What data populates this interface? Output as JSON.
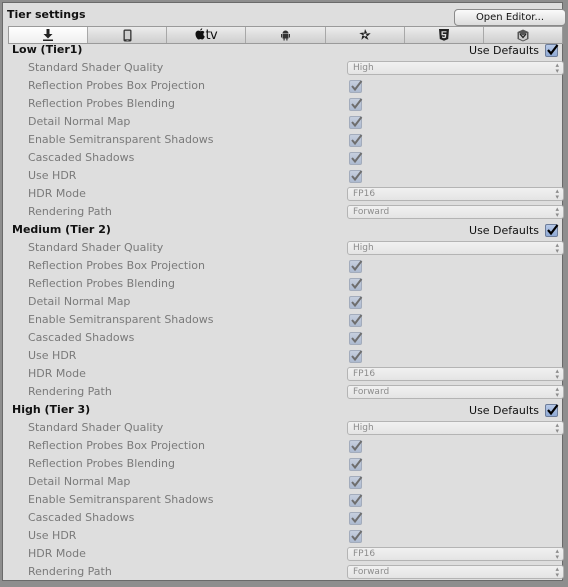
{
  "header": {
    "title": "Tier settings",
    "open_editor_label": "Open Editor..."
  },
  "platform_tabs": [
    {
      "name": "standalone",
      "icon": "download-icon",
      "active": true
    },
    {
      "name": "ios",
      "icon": "phone-icon",
      "active": false
    },
    {
      "name": "appletv",
      "icon": "apple-tv-icon",
      "label": "tv",
      "active": false
    },
    {
      "name": "android",
      "icon": "android-icon",
      "active": false
    },
    {
      "name": "tizen",
      "icon": "tizen-icon",
      "active": false
    },
    {
      "name": "webgl",
      "icon": "html5-icon",
      "active": false
    },
    {
      "name": "samsung-tv",
      "icon": "box-icon",
      "active": false
    }
  ],
  "tiers": [
    {
      "title": "Low (Tier1)",
      "use_defaults_label": "Use Defaults",
      "use_defaults": true,
      "settings": {
        "standard_shader_quality": {
          "label": "Standard Shader Quality",
          "value": "High"
        },
        "reflection_probes_box_projection": {
          "label": "Reflection Probes Box Projection",
          "checked": true
        },
        "reflection_probes_blending": {
          "label": "Reflection Probes Blending",
          "checked": true
        },
        "detail_normal_map": {
          "label": "Detail Normal Map",
          "checked": true
        },
        "enable_semitransparent_shadows": {
          "label": "Enable Semitransparent Shadows",
          "checked": true
        },
        "cascaded_shadows": {
          "label": "Cascaded Shadows",
          "checked": true
        },
        "use_hdr": {
          "label": "Use HDR",
          "checked": true
        },
        "hdr_mode": {
          "label": "HDR Mode",
          "value": "FP16"
        },
        "rendering_path": {
          "label": "Rendering Path",
          "value": "Forward"
        }
      }
    },
    {
      "title": "Medium (Tier 2)",
      "use_defaults_label": "Use Defaults",
      "use_defaults": true,
      "settings": {
        "standard_shader_quality": {
          "label": "Standard Shader Quality",
          "value": "High"
        },
        "reflection_probes_box_projection": {
          "label": "Reflection Probes Box Projection",
          "checked": true
        },
        "reflection_probes_blending": {
          "label": "Reflection Probes Blending",
          "checked": true
        },
        "detail_normal_map": {
          "label": "Detail Normal Map",
          "checked": true
        },
        "enable_semitransparent_shadows": {
          "label": "Enable Semitransparent Shadows",
          "checked": true
        },
        "cascaded_shadows": {
          "label": "Cascaded Shadows",
          "checked": true
        },
        "use_hdr": {
          "label": "Use HDR",
          "checked": true
        },
        "hdr_mode": {
          "label": "HDR Mode",
          "value": "FP16"
        },
        "rendering_path": {
          "label": "Rendering Path",
          "value": "Forward"
        }
      }
    },
    {
      "title": "High (Tier 3)",
      "use_defaults_label": "Use Defaults",
      "use_defaults": true,
      "settings": {
        "standard_shader_quality": {
          "label": "Standard Shader Quality",
          "value": "High"
        },
        "reflection_probes_box_projection": {
          "label": "Reflection Probes Box Projection",
          "checked": true
        },
        "reflection_probes_blending": {
          "label": "Reflection Probes Blending",
          "checked": true
        },
        "detail_normal_map": {
          "label": "Detail Normal Map",
          "checked": true
        },
        "enable_semitransparent_shadows": {
          "label": "Enable Semitransparent Shadows",
          "checked": true
        },
        "cascaded_shadows": {
          "label": "Cascaded Shadows",
          "checked": true
        },
        "use_hdr": {
          "label": "Use HDR",
          "checked": true
        },
        "hdr_mode": {
          "label": "HDR Mode",
          "value": "FP16"
        },
        "rendering_path": {
          "label": "Rendering Path",
          "value": "Forward"
        }
      }
    }
  ]
}
